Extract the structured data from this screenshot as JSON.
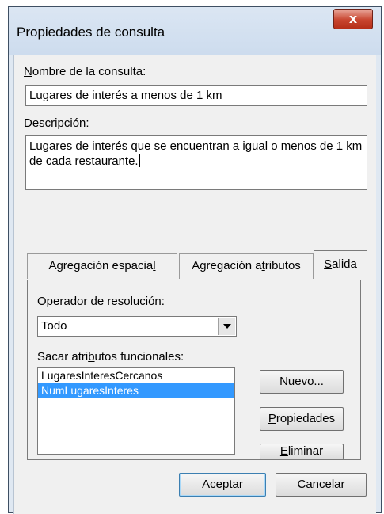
{
  "window": {
    "title": "Propiedades de consulta",
    "close_glyph": "x"
  },
  "form": {
    "name_label_mn": "N",
    "name_label_rest": "ombre de la consulta:",
    "name_value": "Lugares de interés a menos de 1 km",
    "desc_label_mn": "D",
    "desc_label_rest": "escripción:",
    "desc_value": "Lugares de interés que se encuentran a igual o menos de 1 km de cada restaurante."
  },
  "tabs": {
    "spatial_a": "Agregación espacia",
    "spatial_mn": "l",
    "attrs_a": "Agregación a",
    "attrs_mn": "t",
    "attrs_b": "ributos",
    "output_mn": "S",
    "output_b": "alida",
    "active": "Salida"
  },
  "salida": {
    "operator_label_a": "Operador de resolu",
    "operator_label_mn": "c",
    "operator_label_b": "ión:",
    "operator_value": "Todo",
    "attrs_label_a": "Sacar atri",
    "attrs_label_mn": "b",
    "attrs_label_b": "utos funcionales:",
    "list": [
      "LugaresInteresCercanos",
      "NumLugaresInteres"
    ],
    "selected_index": 1,
    "new_mn": "N",
    "new_rest": "uevo...",
    "props_mn": "P",
    "props_rest": "ropiedades",
    "delete_mn": "E",
    "delete_rest": "liminar"
  },
  "footer": {
    "accept": "Aceptar",
    "cancel": "Cancelar"
  },
  "colors": {
    "selection": "#3399ff",
    "close": "#c8452f"
  }
}
